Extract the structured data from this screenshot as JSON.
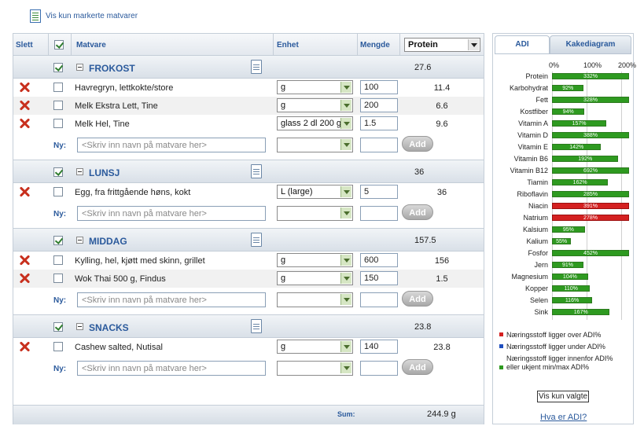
{
  "top_link": {
    "label": "Vis kun markerte matvarer"
  },
  "header": {
    "slett": "Slett",
    "matvare": "Matvare",
    "enhet": "Enhet",
    "mengde": "Mengde",
    "nutrient_select": "Protein"
  },
  "groups": [
    {
      "name": "FROKOST",
      "value": "27.6",
      "rows": [
        {
          "name": "Havregryn, lettkokte/store",
          "unit": "g",
          "amount": "100",
          "value": "11.4"
        },
        {
          "name": "Melk Ekstra Lett, Tine",
          "unit": "g",
          "amount": "200",
          "value": "6.6"
        },
        {
          "name": "Melk Hel, Tine",
          "unit": "glass 2 dl 200 g",
          "amount": "1.5",
          "value": "9.6"
        }
      ]
    },
    {
      "name": "LUNSJ",
      "value": "36",
      "rows": [
        {
          "name": "Egg, fra frittgående høns, kokt",
          "unit": "L (large)",
          "amount": "5",
          "value": "36"
        }
      ]
    },
    {
      "name": "MIDDAG",
      "value": "157.5",
      "rows": [
        {
          "name": "Kylling, hel, kjøtt med skinn, grillet",
          "unit": "g",
          "amount": "600",
          "value": "156"
        },
        {
          "name": "Wok Thai 500 g, Findus",
          "unit": "g",
          "amount": "150",
          "value": "1.5"
        }
      ]
    },
    {
      "name": "SNACKS",
      "value": "23.8",
      "rows": [
        {
          "name": "Cashew salted, Nutisal",
          "unit": "g",
          "amount": "140",
          "value": "23.8"
        }
      ]
    }
  ],
  "new_row": {
    "label": "Ny:",
    "placeholder": "<Skriv inn navn på matvare her>",
    "add_label": "Add"
  },
  "sum": {
    "label": "Sum:",
    "value": "244.9 g"
  },
  "panel": {
    "tab_adi": "ADI",
    "tab_pie": "Kakediagram",
    "ticks": [
      "0%",
      "100%",
      "200%"
    ],
    "colors": {
      "over": "#d42020",
      "under": "#1f4fbf",
      "within": "#2e9a20"
    },
    "nutrients": [
      {
        "name": "Protein",
        "pct": "332%",
        "value": 332,
        "status": "within"
      },
      {
        "name": "Karbohydrat",
        "pct": "92%",
        "value": 92,
        "status": "within"
      },
      {
        "name": "Fett",
        "pct": "328%",
        "value": 328,
        "status": "within"
      },
      {
        "name": "Kostfiber",
        "pct": "94%",
        "value": 94,
        "status": "within"
      },
      {
        "name": "Vitamin A",
        "pct": "157%",
        "value": 157,
        "status": "within"
      },
      {
        "name": "Vitamin D",
        "pct": "388%",
        "value": 388,
        "status": "within"
      },
      {
        "name": "Vitamin E",
        "pct": "142%",
        "value": 142,
        "status": "within"
      },
      {
        "name": "Vitamin B6",
        "pct": "192%",
        "value": 192,
        "status": "within"
      },
      {
        "name": "Vitamin B12",
        "pct": "692%",
        "value": 692,
        "status": "within"
      },
      {
        "name": "Tiamin",
        "pct": "162%",
        "value": 162,
        "status": "within"
      },
      {
        "name": "Riboflavin",
        "pct": "285%",
        "value": 285,
        "status": "within"
      },
      {
        "name": "Niacin",
        "pct": "391%",
        "value": 391,
        "status": "over"
      },
      {
        "name": "Natrium",
        "pct": "278%",
        "value": 278,
        "status": "over"
      },
      {
        "name": "Kalsium",
        "pct": "95%",
        "value": 95,
        "status": "within"
      },
      {
        "name": "Kalium",
        "pct": "55%",
        "value": 55,
        "status": "within"
      },
      {
        "name": "Fosfor",
        "pct": "452%",
        "value": 452,
        "status": "within"
      },
      {
        "name": "Jern",
        "pct": "91%",
        "value": 91,
        "status": "within"
      },
      {
        "name": "Magnesium",
        "pct": "104%",
        "value": 104,
        "status": "within"
      },
      {
        "name": "Kopper",
        "pct": "110%",
        "value": 110,
        "status": "within"
      },
      {
        "name": "Selen",
        "pct": "116%",
        "value": 116,
        "status": "within"
      },
      {
        "name": "Sink",
        "pct": "167%",
        "value": 167,
        "status": "within"
      }
    ],
    "legend_over": "Næringsstoff ligger over ADI%",
    "legend_under": "Næringsstoff ligger under ADI%",
    "legend_within": "Næringsstoff ligger innenfor ADI% eller ukjent min/max ADI%",
    "btn_vis": "Vis kun valgte",
    "link_hva": "Hva er ADI?"
  }
}
